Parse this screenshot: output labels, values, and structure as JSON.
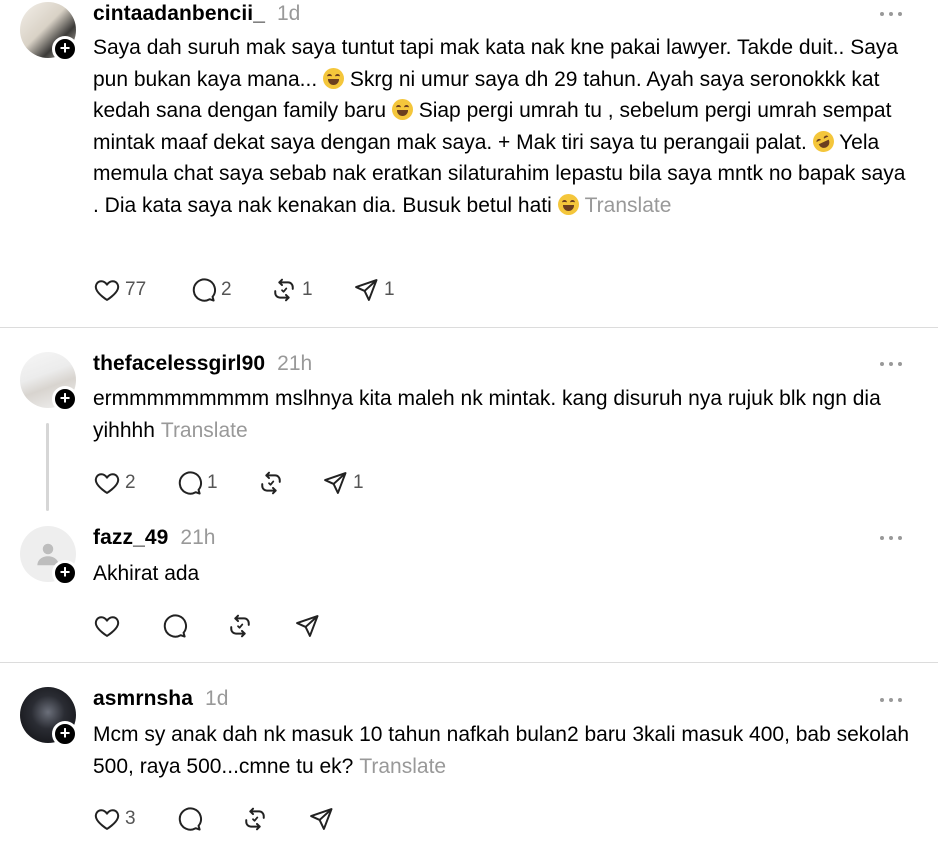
{
  "posts": [
    {
      "username": "cintaadanbencii_",
      "time": "1d",
      "segments": [
        "Saya dah suruh mak saya tuntut tapi mak kata nak kne pakai lawyer. Takde duit.. Saya pun bukan kaya mana... ",
        " Skrg ni umur saya dh 29 tahun. Ayah saya seronokkk kat kedah sana dengan family baru ",
        " Siap pergi umrah tu , sebelum pergi umrah sempat mintak maaf dekat saya dengan mak saya. + Mak tiri saya tu perangaii palat. ",
        " Yela memula chat saya sebab nak eratkan silaturahim lepastu bila saya mntk no bapak saya . Dia kata saya nak kenakan dia. Busuk betul hati "
      ],
      "emojis": [
        "face-with-tears-of-joy",
        "face-with-tears-of-joy",
        "rolling-on-floor-laughing",
        "face-with-tears-of-joy"
      ],
      "translate": "Translate",
      "likes": "77",
      "replies": "2",
      "reposts": "1",
      "shares": "1"
    },
    {
      "username": "thefacelessgirl90",
      "time": "21h",
      "text": "ermmmmmmmmm mslhnya kita maleh nk mintak. kang disuruh nya rujuk blk ngn dia yihhhh",
      "translate": "Translate",
      "likes": "2",
      "replies": "1",
      "shares": "1"
    },
    {
      "username": "fazz_49",
      "time": "21h",
      "text": "Akhirat ada"
    },
    {
      "username": "asmrnsha",
      "time": "1d",
      "text": "Mcm sy anak dah nk masuk 10 tahun nafkah bulan2 baru 3kali masuk 400, bab sekolah 500, raya 500...cmne tu ek?",
      "translate": "Translate",
      "likes": "3"
    }
  ],
  "icons": {
    "like": "heart-icon",
    "reply": "comment-bubble-icon",
    "repost": "repost-icon",
    "share": "send-icon",
    "more": "more-dots-icon",
    "follow": "plus-icon"
  },
  "colors": {
    "text": "#000000",
    "muted": "#999999",
    "divider": "#dcdcdc",
    "badge": "#000000"
  }
}
